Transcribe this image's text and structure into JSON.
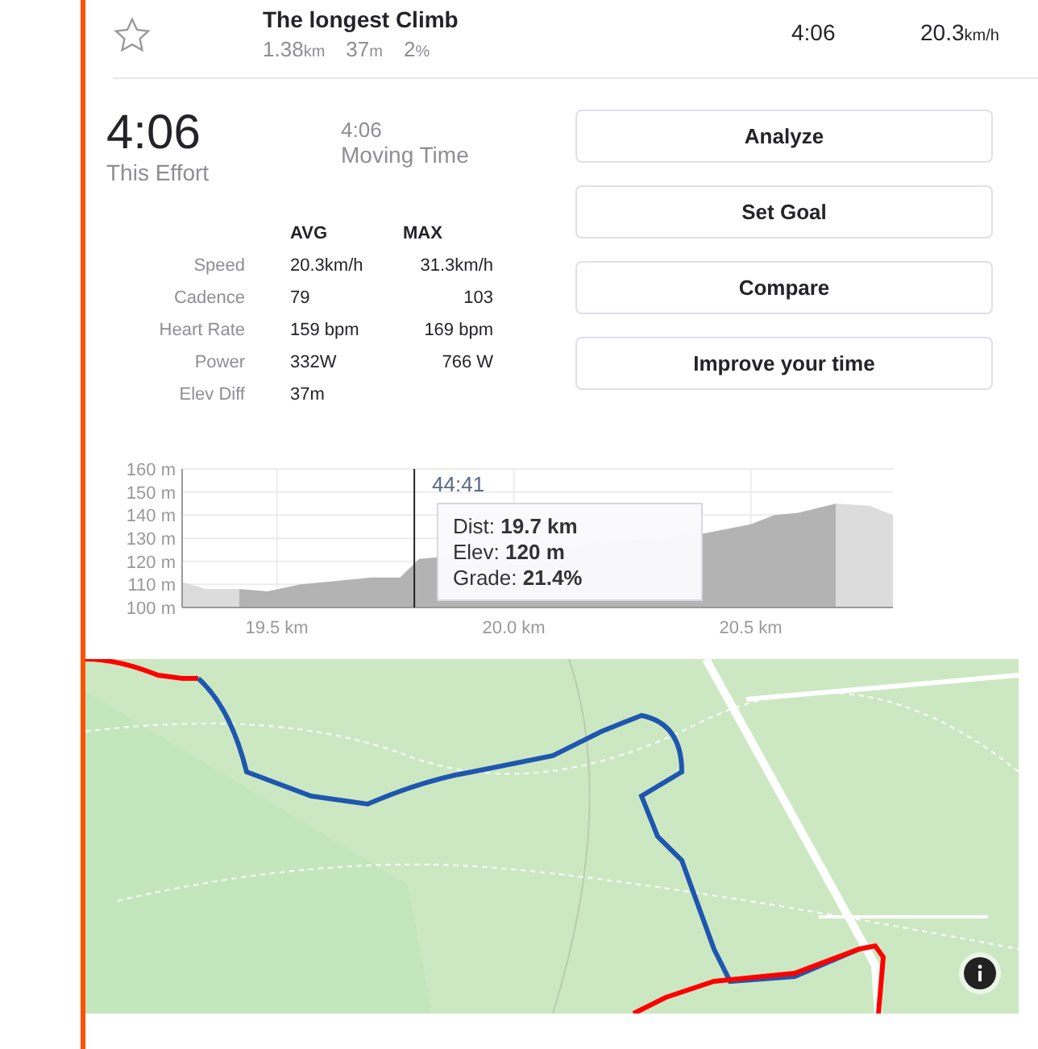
{
  "segment": {
    "starred": false,
    "title": "The longest Climb",
    "stats": [
      {
        "value": "1.38",
        "unit": "km"
      },
      {
        "value": "37",
        "unit": "m"
      },
      {
        "value": "2",
        "unit": "%"
      }
    ],
    "time": "4:06",
    "speed": {
      "value": "20.3",
      "unit": "km/h"
    }
  },
  "effort": {
    "time": "4:06",
    "time_label": "This Effort",
    "moving": "4:06",
    "moving_label": "Moving Time"
  },
  "table": {
    "columns": [
      "AVG",
      "MAX"
    ],
    "rows": [
      {
        "label": "Speed",
        "avg": "20.3km/h",
        "max": "31.3km/h"
      },
      {
        "label": "Cadence",
        "avg": "79",
        "max": "103"
      },
      {
        "label": "Heart Rate",
        "avg": "159 bpm",
        "max": "169 bpm"
      },
      {
        "label": "Power",
        "avg": "332W",
        "max": "766 W"
      },
      {
        "label": "Elev Diff",
        "avg": "37m",
        "max": ""
      }
    ]
  },
  "buttons": [
    "Analyze",
    "Set Goal",
    "Compare",
    "Improve your time"
  ],
  "elevation": {
    "cursor_time": "44:41",
    "tooltip": [
      {
        "label": "Dist:",
        "value": "19.7 km"
      },
      {
        "label": "Elev:",
        "value": "120 m"
      },
      {
        "label": "Grade:",
        "value": "21.4%"
      }
    ],
    "chart_data": {
      "type": "area",
      "x": [
        19.3,
        19.35,
        19.42,
        19.48,
        19.55,
        19.6,
        19.7,
        19.76,
        19.8,
        19.9,
        20.0,
        20.1,
        20.2,
        20.3,
        20.4,
        20.5,
        20.55,
        20.6,
        20.68,
        20.75,
        20.8
      ],
      "series": [
        {
          "color": "#b3b3b3",
          "values": [
            111,
            108,
            108,
            107,
            110,
            111,
            113,
            113,
            121,
            null,
            null,
            null,
            null,
            null,
            132,
            136,
            140,
            141,
            145,
            144,
            140
          ]
        }
      ],
      "grid": true,
      "ref_lines": [
        {
          "axis": "x",
          "value": 19.79,
          "color": "#222222"
        }
      ],
      "xlim": [
        19.3,
        20.8
      ],
      "ylim": [
        100,
        160
      ],
      "xticks": [
        {
          "value": 19.5,
          "label": "19.5 km"
        },
        {
          "value": 20.0,
          "label": "20.0 km"
        },
        {
          "value": 20.5,
          "label": "20.5 km"
        }
      ],
      "yticks": [
        {
          "value": 100,
          "label": "100 m"
        },
        {
          "value": 110,
          "label": "110 m"
        },
        {
          "value": 120,
          "label": "120 m"
        },
        {
          "value": 130,
          "label": "130 m"
        },
        {
          "value": 140,
          "label": "140 m"
        },
        {
          "value": 150,
          "label": "150 m"
        },
        {
          "value": 160,
          "label": "160 m"
        }
      ]
    }
  },
  "map": {
    "kind": "picture"
  }
}
